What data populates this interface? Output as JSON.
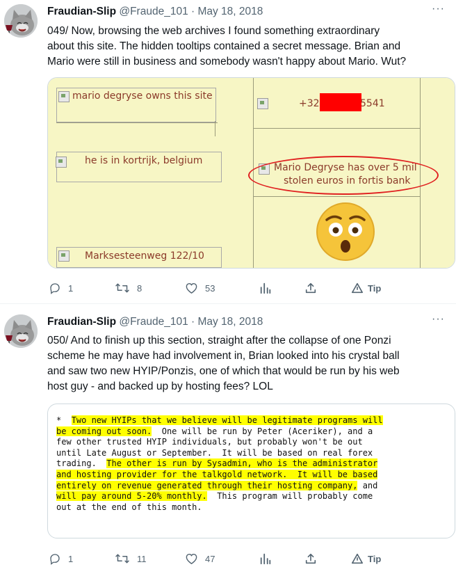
{
  "tweets": [
    {
      "author_name": "Fraudian-Slip",
      "handle_date": "@Fraude_101 · May 18, 2018",
      "lines": [
        "049/ Now, browsing the web archives I found something extraordinary",
        "about this site. The hidden tooltips contained a secret message. Brian and",
        "Mario were still in business and somebody wasn't happy about Mario. Wut?"
      ],
      "image": {
        "tooltips": {
          "owns": "mario degryse owns this site",
          "kortrijk": "he is in kortrijk, belgium",
          "address": "Marksesteenweg 122/10",
          "phone_prefix": "+32 (",
          "phone_suffix": "5541",
          "stolen_line1": "Mario Degryse has over 5 mil",
          "stolen_line2": "stolen euros in fortis bank"
        },
        "emoji": "😳"
      },
      "actions": {
        "reply": "1",
        "retweet": "8",
        "like": "53",
        "tip": "Tip"
      }
    },
    {
      "author_name": "Fraudian-Slip",
      "handle_date": "@Fraude_101 · May 18, 2018",
      "lines": [
        "050/ And to finish up this section, straight after the collapse of one Ponzi",
        "scheme he may have had involvement in, Brian looked into his crystal ball",
        "and saw two new HYIP/Ponzis, one of which that would be run by his web",
        "host guy - and backed up by hosting fees? LOL"
      ],
      "code_lines": [
        [
          {
            "t": "*  "
          },
          {
            "t": "Two new HYIPs that we believe will be legitimate programs will",
            "h": true
          }
        ],
        [
          {
            "t": "be coming out soon.",
            "h": true
          },
          {
            "t": "  One will be run by Peter (Aceriker), and a"
          }
        ],
        [
          {
            "t": "few other trusted HYIP individuals, but probably won't be out"
          }
        ],
        [
          {
            "t": "until Late August or September.  It will be based on real forex"
          }
        ],
        [
          {
            "t": "trading.  "
          },
          {
            "t": "The other is run by Sysadmin, who is the administrator",
            "h": true
          }
        ],
        [
          {
            "t": "and hosting provider for the talkgold network.  It will be based",
            "h": true
          }
        ],
        [
          {
            "t": "entirely on revenue generated through their hosting company,",
            "h": true
          },
          {
            "t": " and"
          }
        ],
        [
          {
            "t": "will pay around 5-20% monthly.",
            "h": true
          },
          {
            "t": "  This program will probably come"
          }
        ],
        [
          {
            "t": "out at the end of this month."
          }
        ]
      ],
      "actions": {
        "reply": "1",
        "retweet": "11",
        "like": "47",
        "tip": "Tip"
      }
    }
  ],
  "more_icon": "more-horizontal-icon",
  "colors": {
    "highlight": "#ffff00",
    "tooltip_text": "#8b3a2a",
    "screenshot_bg": "#f7f6c5",
    "ellipse": "#e02020",
    "redaction": "#ff0000"
  }
}
